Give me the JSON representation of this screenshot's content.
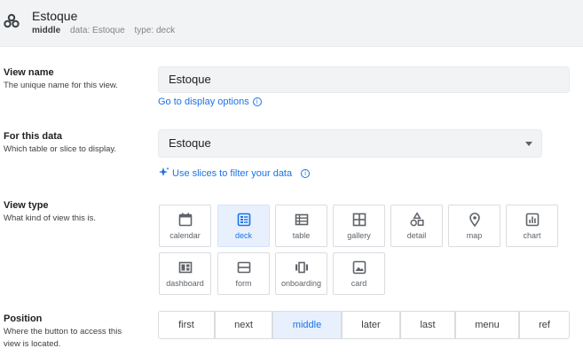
{
  "header": {
    "title": "Estoque",
    "position": "middle",
    "data_text": "data: Estoque",
    "type_text": "type: deck",
    "icon": "app-icon"
  },
  "view_name": {
    "title": "View name",
    "description": "The unique name for this view.",
    "value": "Estoque",
    "link": "Go to display options",
    "link_icon": "info-icon"
  },
  "this_data": {
    "title": "For this data",
    "description": "Which table or slice to display.",
    "selected": "Estoque",
    "link": "Use slices to filter your data",
    "link_icons": [
      "sparkle-icon",
      "info-icon"
    ]
  },
  "view_type": {
    "title": "View type",
    "description": "What kind of view this is.",
    "selected": "deck",
    "options": [
      {
        "label": "calendar",
        "icon": "calendar-icon"
      },
      {
        "label": "deck",
        "icon": "deck-icon"
      },
      {
        "label": "table",
        "icon": "table-icon"
      },
      {
        "label": "gallery",
        "icon": "gallery-icon"
      },
      {
        "label": "detail",
        "icon": "detail-icon"
      },
      {
        "label": "map",
        "icon": "map-pin-icon"
      },
      {
        "label": "chart",
        "icon": "chart-icon"
      },
      {
        "label": "dashboard",
        "icon": "dashboard-icon"
      },
      {
        "label": "form",
        "icon": "form-icon"
      },
      {
        "label": "onboarding",
        "icon": "onboarding-icon"
      },
      {
        "label": "card",
        "icon": "card-icon"
      }
    ]
  },
  "position": {
    "title": "Position",
    "description_line1": "Where the button to access this",
    "description_line2": "view is located.",
    "selected": "middle",
    "options": [
      "first",
      "next",
      "middle",
      "later",
      "last",
      "menu",
      "ref"
    ]
  },
  "colors": {
    "accent": "#1a73e8",
    "selected_bg": "#e8f0fe",
    "field_bg": "#f1f3f4"
  }
}
